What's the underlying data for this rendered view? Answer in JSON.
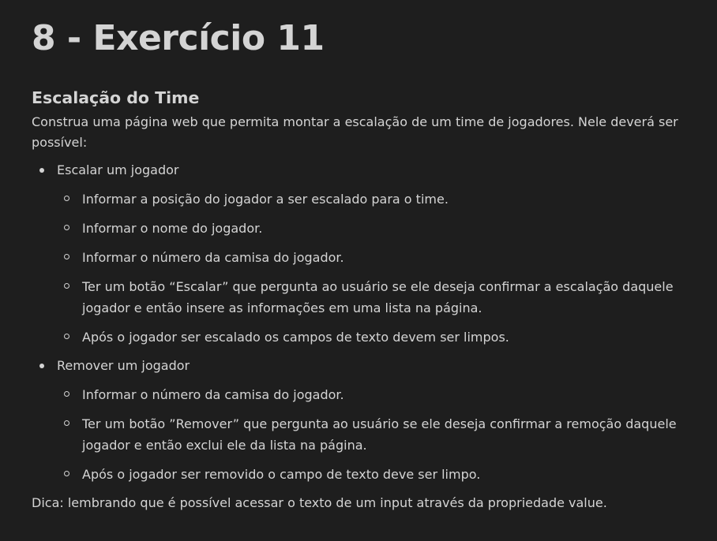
{
  "title": "8 - Exercício 11",
  "section_heading": "Escalação do Time",
  "intro": "Construa uma página web que permita montar a escalação de um time de jogadores. Nele deverá ser possível:",
  "items": [
    {
      "label": "Escalar um jogador",
      "subitems": [
        "Informar a posição do jogador a ser escalado para o time.",
        "Informar o nome do jogador.",
        "Informar o número da camisa do jogador.",
        "Ter um botão “Escalar” que pergunta ao usuário se ele deseja confirmar a escalação daquele jogador e então insere as informações em uma lista na página.",
        "Após o jogador ser escalado os campos de texto devem ser limpos."
      ]
    },
    {
      "label": "Remover um jogador",
      "subitems": [
        "Informar o número da camisa do jogador.",
        "Ter um botão ”Remover” que pergunta ao usuário se ele deseja confirmar a remoção daquele jogador e então exclui ele da lista na página.",
        "Após o jogador ser removido o campo de texto deve ser limpo."
      ]
    }
  ],
  "tip": "Dica: lembrando que é possível acessar o texto de um input através da propriedade value.",
  "colors": {
    "background": "#1e1e1e",
    "text": "#d4d4d4"
  }
}
